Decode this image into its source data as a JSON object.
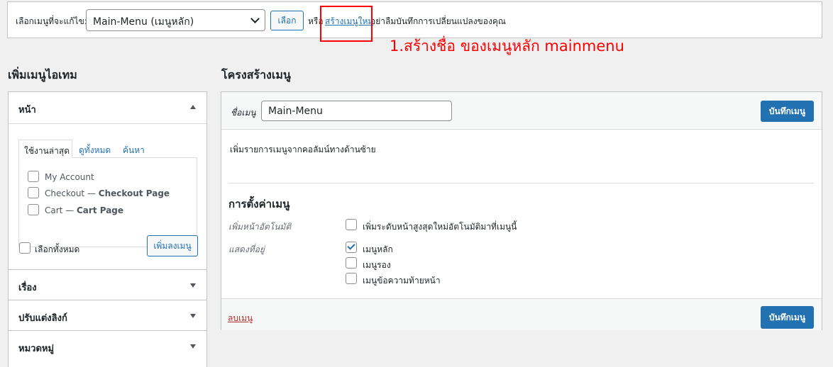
{
  "top_bar": {
    "select_label": "เลือกเมนูที่จะแก้ไข:",
    "select_value": "Main-Menu (เมนูหลัก)",
    "select_button": "เลือก",
    "or_text": "หรือ",
    "create_link": "สร้างเมนูใหม่",
    "reminder": "อย่าลืมบันทึกการเปลี่ยนแปลงของคุณ"
  },
  "annotation": {
    "text": "1.สร้างชื่อ ของเมนูหลัก mainmenu",
    "color": "#ff0000"
  },
  "left": {
    "heading": "เพิ่มเมนูไอเทม",
    "pages_section": {
      "title": "หน้า",
      "tabs": [
        "ใช้งานล่าสุด",
        "ดูทั้งหมด",
        "ค้นหา"
      ],
      "items": [
        {
          "label": "My Account",
          "bold": ""
        },
        {
          "label": "Checkout — ",
          "bold": "Checkout Page"
        },
        {
          "label": "Cart — ",
          "bold": "Cart Page"
        }
      ],
      "select_all": "เลือกทั้งหมด",
      "add_button": "เพิ่มลงเมนู"
    },
    "sections": [
      "เรื่อง",
      "ปรับแต่งลิงก์",
      "หมวดหมู่"
    ]
  },
  "right": {
    "heading": "โครงสร้างเมนู",
    "name_label": "ชื่อเมนู",
    "name_value": "Main-Menu",
    "save_label": "บันทึกเมนู",
    "instructions": "เพิ่มรายการเมนูจากคอลัมน์ทางด้านซ้าย",
    "settings": {
      "title": "การตั้งค่าเมนู",
      "auto_add_label": "เพิ่มหน้าอัตโนมัติ",
      "auto_add_option": "เพิ่มระดับหน้าสูงสุดใหม่อัตโนมัติมาที่เมนูนี้",
      "display_label": "แสดงที่อยู่",
      "locations": [
        {
          "label": "เมนูหลัก",
          "checked": true
        },
        {
          "label": "เมนูรอง",
          "checked": false
        },
        {
          "label": "เมนูข้อความท้ายหน้า",
          "checked": false
        }
      ]
    },
    "delete_label": "ลบเมนู"
  },
  "colors": {
    "primary": "#2271b1",
    "danger": "#b32d2e",
    "annotation": "#ff0000"
  }
}
